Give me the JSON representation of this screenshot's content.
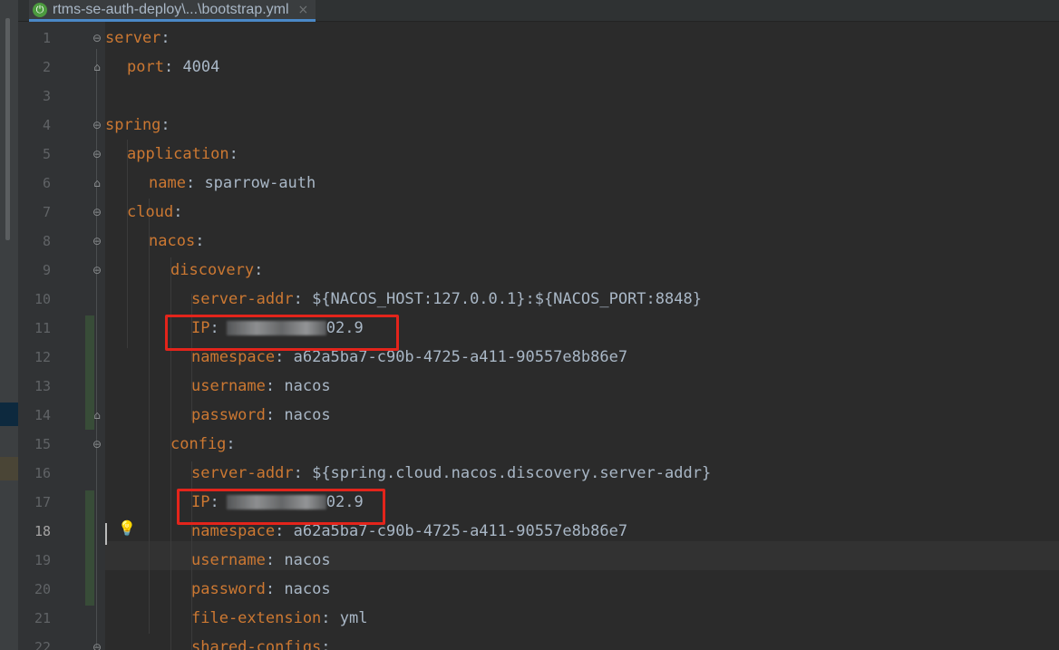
{
  "tab": {
    "icon": "spring-boot-icon",
    "title": "rtms-se-auth-deploy\\...\\bootstrap.yml",
    "close": "×"
  },
  "gutter": {
    "line_numbers": [
      "1",
      "2",
      "3",
      "4",
      "5",
      "6",
      "7",
      "8",
      "9",
      "10",
      "11",
      "12",
      "13",
      "14",
      "15",
      "16",
      "17",
      "18",
      "19",
      "20",
      "21",
      "22"
    ],
    "current_line": "18"
  },
  "code": [
    {
      "key": "server",
      "sep": ":",
      "val": ""
    },
    {
      "key": "port",
      "sep": ":",
      "val": " 4004"
    },
    {
      "key": "",
      "sep": "",
      "val": ""
    },
    {
      "key": "spring",
      "sep": ":",
      "val": ""
    },
    {
      "key": "application",
      "sep": ":",
      "val": ""
    },
    {
      "key": "name",
      "sep": ":",
      "val": " sparrow-auth"
    },
    {
      "key": "cloud",
      "sep": ":",
      "val": ""
    },
    {
      "key": "nacos",
      "sep": ":",
      "val": ""
    },
    {
      "key": "discovery",
      "sep": ":",
      "val": ""
    },
    {
      "key": "server-addr",
      "sep": ":",
      "val": " ${NACOS_HOST:127.0.0.1}:${NACOS_PORT:8848}"
    },
    {
      "key": "IP",
      "sep": ":",
      "val": "02.9"
    },
    {
      "key": "namespace",
      "sep": ":",
      "val": " a62a5ba7-c90b-4725-a411-90557e8b86e7"
    },
    {
      "key": "username",
      "sep": ":",
      "val": " nacos"
    },
    {
      "key": "password",
      "sep": ":",
      "val": " nacos"
    },
    {
      "key": "config",
      "sep": ":",
      "val": ""
    },
    {
      "key": "server-addr",
      "sep": ":",
      "val": " ${spring.cloud.nacos.discovery.server-addr}"
    },
    {
      "key": "IP",
      "sep": ":",
      "val": "02.9"
    },
    {
      "key": "namespace",
      "sep": ":",
      "val": " a62a5ba7-c90b-4725-a411-90557e8b86e7"
    },
    {
      "key": "username",
      "sep": ":",
      "val": " nacos"
    },
    {
      "key": "password",
      "sep": ":",
      "val": " nacos"
    },
    {
      "key": "file-extension",
      "sep": ":",
      "val": " yml"
    },
    {
      "key": "shared-configs",
      "sep": ":",
      "val": ""
    }
  ],
  "colors": {
    "key": "#cc7832",
    "text": "#a9b7c6",
    "highlight_box": "#e3241b",
    "bulb": "#f0b400"
  }
}
